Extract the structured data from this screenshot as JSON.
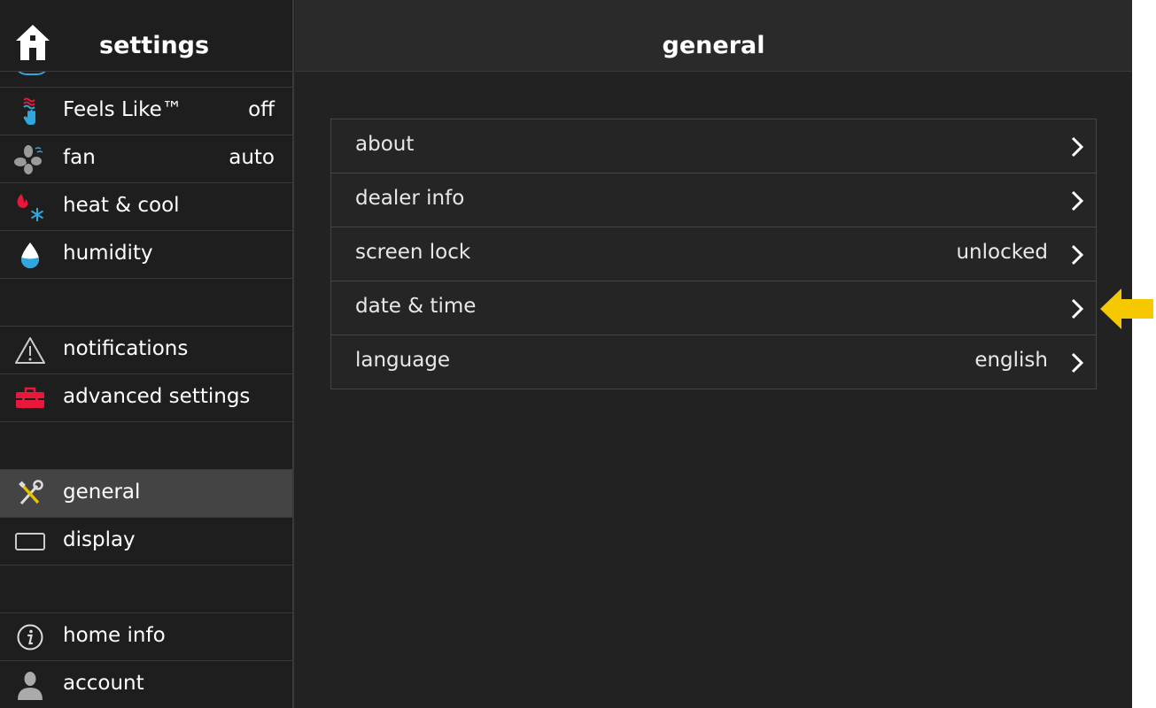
{
  "sidebar": {
    "title": "settings",
    "items": [
      {
        "label": "Feels Like™",
        "value": "off",
        "icon": "feels-like-icon"
      },
      {
        "label": "fan",
        "value": "auto",
        "icon": "fan-icon"
      },
      {
        "label": "heat & cool",
        "value": "",
        "icon": "heat-cool-icon"
      },
      {
        "label": "humidity",
        "value": "",
        "icon": "water-drop-icon"
      },
      {
        "label": "notifications",
        "value": "",
        "icon": "warning-icon"
      },
      {
        "label": "advanced settings",
        "value": "",
        "icon": "toolbox-icon"
      },
      {
        "label": "general",
        "value": "",
        "icon": "tools-icon"
      },
      {
        "label": "display",
        "value": "",
        "icon": "display-icon"
      },
      {
        "label": "home info",
        "value": "",
        "icon": "info-icon"
      },
      {
        "label": "account",
        "value": "",
        "icon": "account-icon"
      }
    ],
    "active_item": "general"
  },
  "main": {
    "title": "general",
    "rows": [
      {
        "label": "about",
        "value": ""
      },
      {
        "label": "dealer info",
        "value": ""
      },
      {
        "label": "screen lock",
        "value": "unlocked"
      },
      {
        "label": "date & time",
        "value": ""
      },
      {
        "label": "language",
        "value": "english"
      }
    ]
  },
  "colors": {
    "background": "#222222",
    "sidebar_active": "#444444",
    "accent_blue": "#2fa6dd",
    "accent_red": "#e8173c",
    "pointer_yellow": "#f5c800"
  },
  "icons": {
    "home": "home-icon",
    "chevron": "chevron-right-icon",
    "pointer": "yellow-arrow-left-icon"
  }
}
